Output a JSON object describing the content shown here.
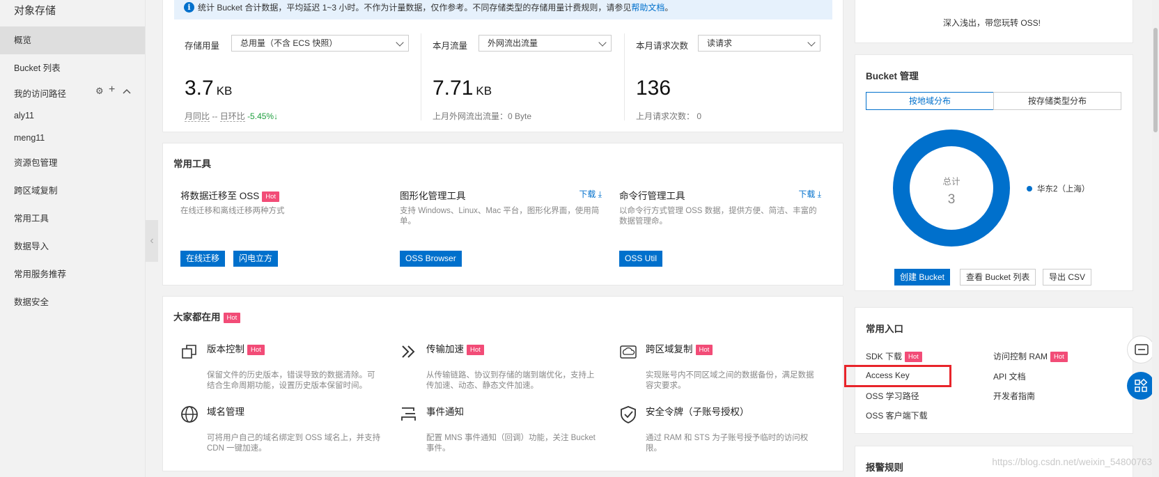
{
  "sidebar": {
    "title": "对象存储",
    "items": [
      "概览",
      "Bucket 列表"
    ],
    "paths_label": "我的访问路径",
    "path_icons": [
      "gear-icon",
      "plus-icon",
      "chevron-up-icon"
    ],
    "paths": [
      "aly11",
      "meng11"
    ],
    "more_items": [
      "资源包管理",
      "跨区域复制",
      "常用工具",
      "数据导入",
      "常用服务推荐",
      "数据安全"
    ]
  },
  "notice": {
    "text": "统计 Bucket 合计数据，平均延迟 1~3 小时。不作为计量数据，仅作参考。不同存储类型的存储用量计费规则，请参见",
    "link": "帮助文档",
    "end": "。"
  },
  "stats": [
    {
      "label": "存储用量",
      "select": "总用量（不含 ECS 快照）",
      "value": "3.7",
      "unit": "KB",
      "sub_a": "月同比",
      "sub_b": "--",
      "sub_c": "日环比",
      "sub_d": "-5.45%",
      "sub_arrow": "↓"
    },
    {
      "label": "本月流量",
      "select": "外网流出流量",
      "value": "7.71",
      "unit": "KB",
      "sub": "上月外网流出流量：0 Byte"
    },
    {
      "label": "本月请求次数",
      "select": "读请求",
      "value": "136",
      "unit": "",
      "sub": "上月请求次数：  0"
    }
  ],
  "tools": {
    "title": "常用工具",
    "items": [
      {
        "name": "将数据迁移至 OSS",
        "hot": "Hot",
        "desc": "在线迁移和离线迁移两种方式",
        "buttons": [
          "在线迁移",
          "闪电立方"
        ]
      },
      {
        "name": "图形化管理工具",
        "download": "下载",
        "desc": "支持 Windows、Linux、Mac 平台，图形化界面，使用简单。",
        "buttons": [
          "OSS Browser"
        ]
      },
      {
        "name": "命令行管理工具",
        "download": "下载",
        "desc": "以命令行方式管理 OSS 数据，提供方便、简洁、丰富的数据管理命。",
        "buttons": [
          "OSS Util"
        ]
      }
    ]
  },
  "popular": {
    "title": "大家都在用",
    "hot": "Hot",
    "items": [
      {
        "name": "版本控制",
        "hot": "Hot",
        "icon": "copy-icon",
        "desc": "保留文件的历史版本，错误导致的数据清除。可结合生命周期功能，设置历史版本保留时间。"
      },
      {
        "name": "传输加速",
        "hot": "Hot",
        "icon": "double-chevron-icon",
        "desc": "从传输链路、协议到存储的端到端优化，支持上传加速、动态、静态文件加速。"
      },
      {
        "name": "跨区域复制",
        "hot": "Hot",
        "icon": "cloud-sync-icon",
        "desc": "实现账号内不同区域之间的数据备份，满足数据容灾要求。"
      },
      {
        "name": "域名管理",
        "icon": "globe-icon",
        "desc": "可将用户自己的域名绑定到 OSS 域名上，并支持 CDN 一键加速。"
      },
      {
        "name": "事件通知",
        "icon": "notify-icon",
        "desc": "配置 MNS 事件通知（回调）功能，关注 Bucket 事件。"
      },
      {
        "name": "安全令牌（子账号授权）",
        "icon": "shield-icon",
        "desc": "通过 RAM 和 STS 为子账号授予临时的访问权限。"
      }
    ]
  },
  "right": {
    "top_slogan": "深入浅出，带您玩转 OSS!",
    "bucket_title": "Bucket 管理",
    "tabs": [
      "按地域分布",
      "按存储类型分布"
    ],
    "donut_label": "总计",
    "donut_value": "3",
    "legend": "华东2（上海）",
    "colors": {
      "accent": "#0070cc",
      "hot": "#f24c77",
      "highlight": "#e8242a"
    },
    "buttons": [
      "创建 Bucket",
      "查看 Bucket 列表",
      "导出 CSV"
    ],
    "entry_title": "常用入口",
    "entries": [
      {
        "label": "SDK 下载",
        "hot": "Hot"
      },
      {
        "label": "访问控制 RAM",
        "hot": "Hot"
      },
      {
        "label": "Access Key"
      },
      {
        "label": "API 文档"
      },
      {
        "label": "OSS 学习路径"
      },
      {
        "label": "开发者指南"
      },
      {
        "label": "OSS 客户端下载"
      }
    ],
    "alarm_title": "报警规则"
  },
  "watermark": "https://blog.csdn.net/weixin_54800763"
}
